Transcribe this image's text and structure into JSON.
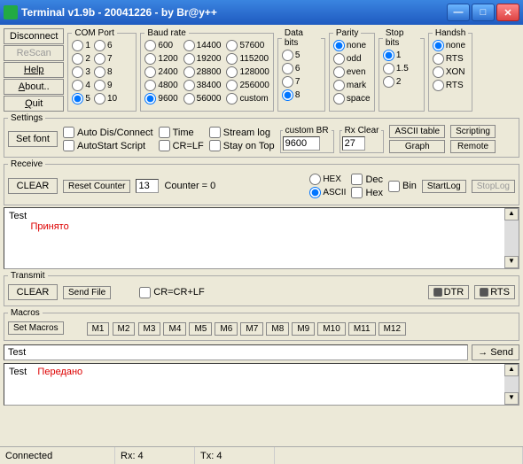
{
  "window": {
    "title": "Terminal v1.9b - 20041226 - by Br@y++"
  },
  "sidebar_buttons": {
    "disconnect": "Disconnect",
    "rescan": "ReScan",
    "help": "Help",
    "about": "About..",
    "quit": "Quit"
  },
  "com": {
    "legend": "COM Port",
    "opts": [
      "1",
      "2",
      "3",
      "4",
      "5",
      "6",
      "7",
      "8",
      "9",
      "10"
    ],
    "selected": "5"
  },
  "baud": {
    "legend": "Baud rate",
    "col1": [
      "600",
      "1200",
      "2400",
      "4800",
      "9600"
    ],
    "col2": [
      "14400",
      "19200",
      "28800",
      "38400",
      "56000"
    ],
    "col3": [
      "57600",
      "115200",
      "128000",
      "256000",
      "custom"
    ],
    "selected": "9600"
  },
  "databits": {
    "legend": "Data bits",
    "opts": [
      "5",
      "6",
      "7",
      "8"
    ],
    "selected": "8"
  },
  "parity": {
    "legend": "Parity",
    "opts": [
      "none",
      "odd",
      "even",
      "mark",
      "space"
    ],
    "selected": "none"
  },
  "stopbits": {
    "legend": "Stop bits",
    "opts": [
      "1",
      "1.5",
      "2"
    ],
    "selected": "1"
  },
  "handshake": {
    "legend": "Handsh",
    "opts": [
      "none",
      "RTS",
      "XON",
      "RTS"
    ],
    "selected": "none"
  },
  "settings": {
    "legend": "Settings",
    "setfont": "Set font",
    "auto_dis": "Auto Dis/Connect",
    "autostart": "AutoStart Script",
    "time": "Time",
    "crlf": "CR=LF",
    "streamlog": "Stream log",
    "stayontop": "Stay on Top",
    "custom_br_label": "custom BR",
    "custom_br_val": "9600",
    "rxclear_label": "Rx Clear",
    "rxclear_val": "27",
    "ascii_table": "ASCII table",
    "graph": "Graph",
    "scripting": "Scripting",
    "remote": "Remote"
  },
  "receive": {
    "legend": "Receive",
    "clear": "CLEAR",
    "reset_counter": "Reset Counter",
    "counter_val": "13",
    "counter_label": "Counter =  0",
    "hex": "HEX",
    "ascii": "ASCII",
    "dec": "Dec",
    "hex2": "Hex",
    "bin": "Bin",
    "startlog": "StartLog",
    "stoplog": "StopLog",
    "test_label": "Test",
    "test_text": "Принято"
  },
  "transmit": {
    "legend": "Transmit",
    "clear": "CLEAR",
    "sendfile": "Send File",
    "crcrlf": "CR=CR+LF",
    "dtr": "DTR",
    "rts": "RTS"
  },
  "macros": {
    "legend": "Macros",
    "setmacros": "Set Macros",
    "btns": [
      "M1",
      "M2",
      "M3",
      "M4",
      "M5",
      "M6",
      "M7",
      "M8",
      "M9",
      "M10",
      "M11",
      "M12"
    ]
  },
  "send": {
    "input_val": "Test",
    "send_btn": "Send"
  },
  "sent_area": {
    "label": "Test",
    "text": "Передано"
  },
  "status": {
    "connected": "Connected",
    "rx": "Rx: 4",
    "tx": "Tx: 4"
  }
}
